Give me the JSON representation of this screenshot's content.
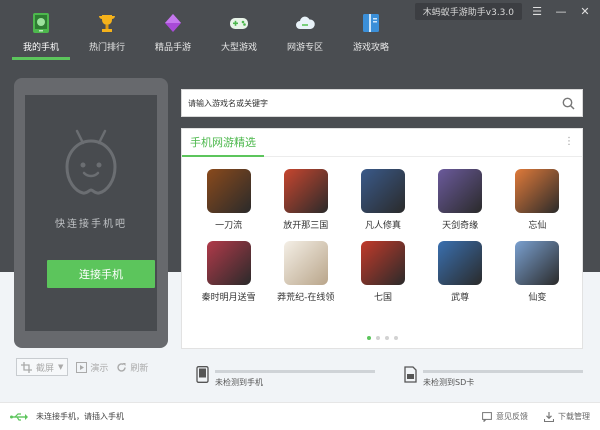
{
  "window": {
    "version": "木蚂蚁手游助手v3.3.0",
    "menu_glyph": "☰",
    "minimize_glyph": "—",
    "close_glyph": "✕"
  },
  "nav": {
    "items": [
      {
        "label": "我的手机",
        "icon": "android-phone-icon"
      },
      {
        "label": "热门排行",
        "icon": "trophy-icon"
      },
      {
        "label": "精品手游",
        "icon": "diamond-icon"
      },
      {
        "label": "大型游戏",
        "icon": "gamepad-icon"
      },
      {
        "label": "网游专区",
        "icon": "cloud-icon"
      },
      {
        "label": "游戏攻略",
        "icon": "guide-book-icon"
      }
    ],
    "active_index": 0
  },
  "phone": {
    "tip": "快连接手机吧",
    "connect_label": "连接手机",
    "tools": {
      "screenshot_label": "截屏",
      "demo_label": "演示",
      "refresh_label": "刷新"
    }
  },
  "search": {
    "placeholder": "请输入游戏名或关键字"
  },
  "panel": {
    "title": "手机网游精选",
    "more_glyph": "⋮",
    "games": [
      {
        "name": "一刀流",
        "color": "#8a4a1c"
      },
      {
        "name": "放开那三国",
        "color": "#c7462f"
      },
      {
        "name": "凡人修真",
        "color": "#3a5a8a"
      },
      {
        "name": "天剑奇缘",
        "color": "#6b5a9c"
      },
      {
        "name": "忘仙",
        "color": "#e07a3a"
      },
      {
        "name": "秦时明月送雪",
        "color": "#b13a4a"
      },
      {
        "name": "莽荒纪-在线领",
        "color": "#efe8dc"
      },
      {
        "name": "七国",
        "color": "#c23a2a"
      },
      {
        "name": "武尊",
        "color": "#3a70b0"
      },
      {
        "name": "仙变",
        "color": "#7aa0d0"
      }
    ],
    "pages": 4,
    "active_page": 0
  },
  "devices": {
    "phone_status": "未检测到手机",
    "sd_status": "未检测到SD卡"
  },
  "footer": {
    "connection_status": "未连接手机，请插入手机",
    "feedback_label": "意见反馈",
    "download_label": "下载管理"
  },
  "colors": {
    "accent": "#5cc55c",
    "dark_bg": "#4a4d51",
    "phone_body": "#67696d"
  }
}
